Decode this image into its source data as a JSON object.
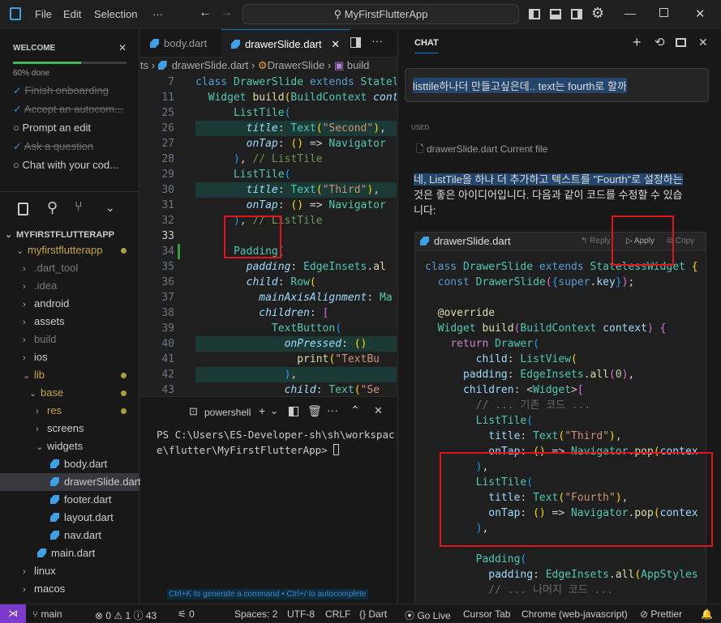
{
  "titlebar": {
    "menu": [
      "File",
      "Edit",
      "Selection",
      "···"
    ],
    "search": "MyFirstFlutterApp"
  },
  "onboarding": {
    "title": "WELCOME",
    "progress_label": "60% done",
    "progress": 0.6,
    "items": [
      {
        "label": "Finish onboarding",
        "done": true
      },
      {
        "label": "Accept an autocom...",
        "done": true
      },
      {
        "label": "Prompt an edit",
        "done": false
      },
      {
        "label": "Ask a question",
        "done": true
      },
      {
        "label": "Chat with your cod...",
        "done": false
      }
    ]
  },
  "explorer": {
    "root": "MYFIRSTFLUTTERAPP",
    "items": [
      {
        "label": "myfirstflutterapp",
        "depth": 0,
        "chev": "⌄",
        "color": "#c5a63a",
        "dot": true
      },
      {
        "label": ".dart_tool",
        "depth": 1,
        "chev": "›",
        "color": "#7a7a7a"
      },
      {
        "label": ".idea",
        "depth": 1,
        "chev": "›",
        "color": "#7a7a7a"
      },
      {
        "label": "android",
        "depth": 1,
        "chev": "›",
        "color": "#ccc"
      },
      {
        "label": "assets",
        "depth": 1,
        "chev": "›",
        "color": "#ccc"
      },
      {
        "label": "build",
        "depth": 1,
        "chev": "›",
        "color": "#7a7a7a"
      },
      {
        "label": "ios",
        "depth": 1,
        "chev": "›",
        "color": "#ccc"
      },
      {
        "label": "lib",
        "depth": 1,
        "chev": "⌄",
        "color": "#c5a63a",
        "dot": true
      },
      {
        "label": "base",
        "depth": 2,
        "chev": "⌄",
        "color": "#c5a63a",
        "dot": true
      },
      {
        "label": "res",
        "depth": 3,
        "chev": "›",
        "color": "#c5a63a",
        "dot": true
      },
      {
        "label": "screens",
        "depth": 3,
        "chev": "›",
        "color": "#ccc"
      },
      {
        "label": "widgets",
        "depth": 3,
        "chev": "⌄",
        "color": "#ccc"
      },
      {
        "label": "body.dart",
        "depth": 4,
        "file": true,
        "color": "#ccc"
      },
      {
        "label": "drawerSlide.dart",
        "depth": 4,
        "file": true,
        "color": "#ccc",
        "selected": true
      },
      {
        "label": "footer.dart",
        "depth": 4,
        "file": true,
        "color": "#ccc"
      },
      {
        "label": "layout.dart",
        "depth": 4,
        "file": true,
        "color": "#ccc"
      },
      {
        "label": "nav.dart",
        "depth": 4,
        "file": true,
        "color": "#ccc"
      },
      {
        "label": "main.dart",
        "depth": 2,
        "file": true,
        "color": "#ccc"
      },
      {
        "label": "linux",
        "depth": 1,
        "chev": "›",
        "color": "#ccc"
      },
      {
        "label": "macos",
        "depth": 1,
        "chev": "›",
        "color": "#ccc"
      }
    ]
  },
  "editor": {
    "tabs": [
      "body.dart",
      "drawerSlide.dart"
    ],
    "breadcrumb": [
      "ts",
      "drawerSlide.dart",
      "DrawerSlide",
      "build"
    ],
    "line_numbers": [
      "7",
      "11",
      "25",
      "26",
      "27",
      "28",
      "29",
      "30",
      "31",
      "32",
      "33",
      "34",
      "35",
      "36",
      "37",
      "38",
      "39",
      "40",
      "41",
      "42",
      "43"
    ],
    "hint": "Ctrl+K to generate a command • Ctrl+/ to autocomplete"
  },
  "terminal": {
    "name": "powershell",
    "line1": "PS C:\\Users\\ES-Developer-sh\\sh\\workspac",
    "line2": "e\\flutter\\MyFirstFlutterApp> "
  },
  "chat": {
    "header": "CHAT",
    "user_message": "listtile하나더 만들고싶은데.. text는 fourth로 할까",
    "used_label": "USED",
    "used_file": "drawerSlide.dart Current file",
    "reply_line1": "네, ListTile을 하나 더 추가하고 텍스트를 \"Fourth\"로 설정하는",
    "reply_line2": "것은 좋은 아이디어입니다. 다음과 같이 코드를 수정할 수 있습",
    "reply_line3": "니다:",
    "code_file": "drawerSlide.dart",
    "btn_reply": "Reply",
    "btn_apply": "Apply",
    "btn_copy": "Copy"
  },
  "status": {
    "branch": "main",
    "errors": "0",
    "warnings": "1",
    "infos": "43",
    "ports": "0",
    "spaces": "Spaces: 2",
    "encoding": "UTF-8",
    "eol": "CRLF",
    "lang": "Dart",
    "golive": "Go Live",
    "cursortab": "Cursor Tab",
    "device": "Chrome (web-javascript)",
    "prettier": "Prettier"
  },
  "colors": {
    "accent": "#0078d4",
    "status_remote": "#7c3acd",
    "highlight": "#e0141b"
  }
}
